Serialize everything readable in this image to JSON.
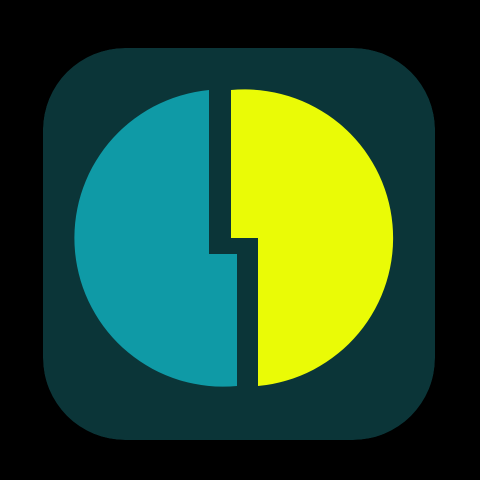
{
  "icon": {
    "name": "split-circle-app-icon",
    "colors": {
      "page_background": "#000000",
      "tile_background": "#0B3538",
      "left_half": "#0F9AA6",
      "right_half": "#EAFB06"
    }
  }
}
